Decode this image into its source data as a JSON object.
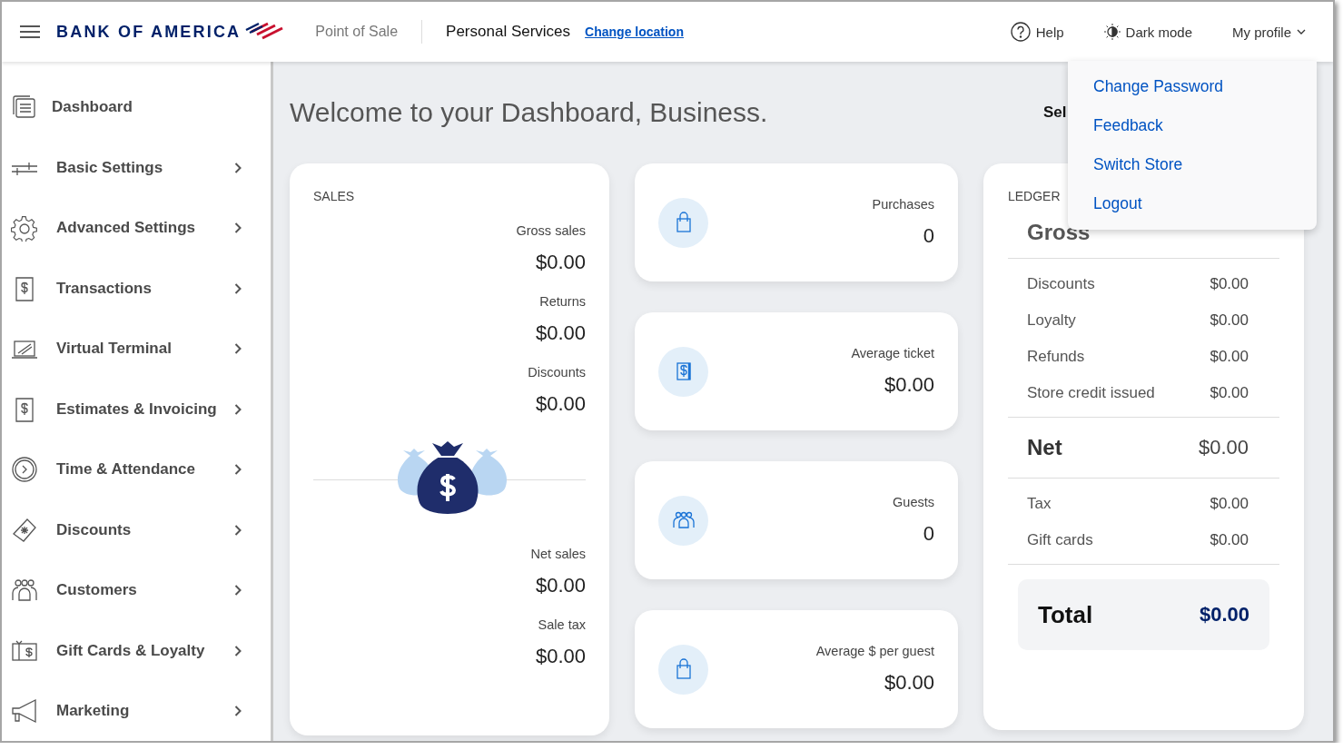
{
  "header": {
    "brand": "BANK OF AMERICA",
    "product": "Point of Sale",
    "location": "Personal Services",
    "change_location": "Change location",
    "help": "Help",
    "dark_mode": "Dark mode",
    "profile": "My profile"
  },
  "profile_menu": {
    "open": true,
    "items": [
      "Change Password",
      "Feedback",
      "Switch Store",
      "Logout"
    ]
  },
  "sidebar": {
    "items": [
      {
        "label": "Dashboard",
        "has_submenu": false
      },
      {
        "label": "Basic Settings",
        "has_submenu": true
      },
      {
        "label": "Advanced Settings",
        "has_submenu": true
      },
      {
        "label": "Transactions",
        "has_submenu": true
      },
      {
        "label": "Virtual Terminal",
        "has_submenu": true
      },
      {
        "label": "Estimates & Invoicing",
        "has_submenu": true
      },
      {
        "label": "Time & Attendance",
        "has_submenu": true
      },
      {
        "label": "Discounts",
        "has_submenu": true
      },
      {
        "label": "Customers",
        "has_submenu": true
      },
      {
        "label": "Gift Cards & Loyalty",
        "has_submenu": true
      },
      {
        "label": "Marketing",
        "has_submenu": true
      }
    ]
  },
  "welcome": "Welcome to your Dashboard, Business.",
  "store_select_label": "Sel",
  "sales": {
    "title": "SALES",
    "top": [
      {
        "label": "Gross sales",
        "value": "$0.00"
      },
      {
        "label": "Returns",
        "value": "$0.00"
      },
      {
        "label": "Discounts",
        "value": "$0.00"
      }
    ],
    "bottom": [
      {
        "label": "Net sales",
        "value": "$0.00"
      },
      {
        "label": "Sale tax",
        "value": "$0.00"
      }
    ]
  },
  "stats": [
    {
      "label": "Purchases",
      "value": "0"
    },
    {
      "label": "Average ticket",
      "value": "$0.00"
    },
    {
      "label": "Guests",
      "value": "0"
    },
    {
      "label": "Average $ per guest",
      "value": "$0.00"
    }
  ],
  "ledger": {
    "title": "LEDGER",
    "gross": {
      "label": "Gross"
    },
    "deductions": [
      {
        "label": "Discounts",
        "value": "$0.00"
      },
      {
        "label": "Loyalty",
        "value": "$0.00"
      },
      {
        "label": "Refunds",
        "value": "$0.00"
      },
      {
        "label": "Store credit issued",
        "value": "$0.00"
      }
    ],
    "net": {
      "label": "Net",
      "value": "$0.00"
    },
    "extras": [
      {
        "label": "Tax",
        "value": "$0.00"
      },
      {
        "label": "Gift cards",
        "value": "$0.00"
      }
    ],
    "total": {
      "label": "Total",
      "value": "$0.00"
    }
  }
}
